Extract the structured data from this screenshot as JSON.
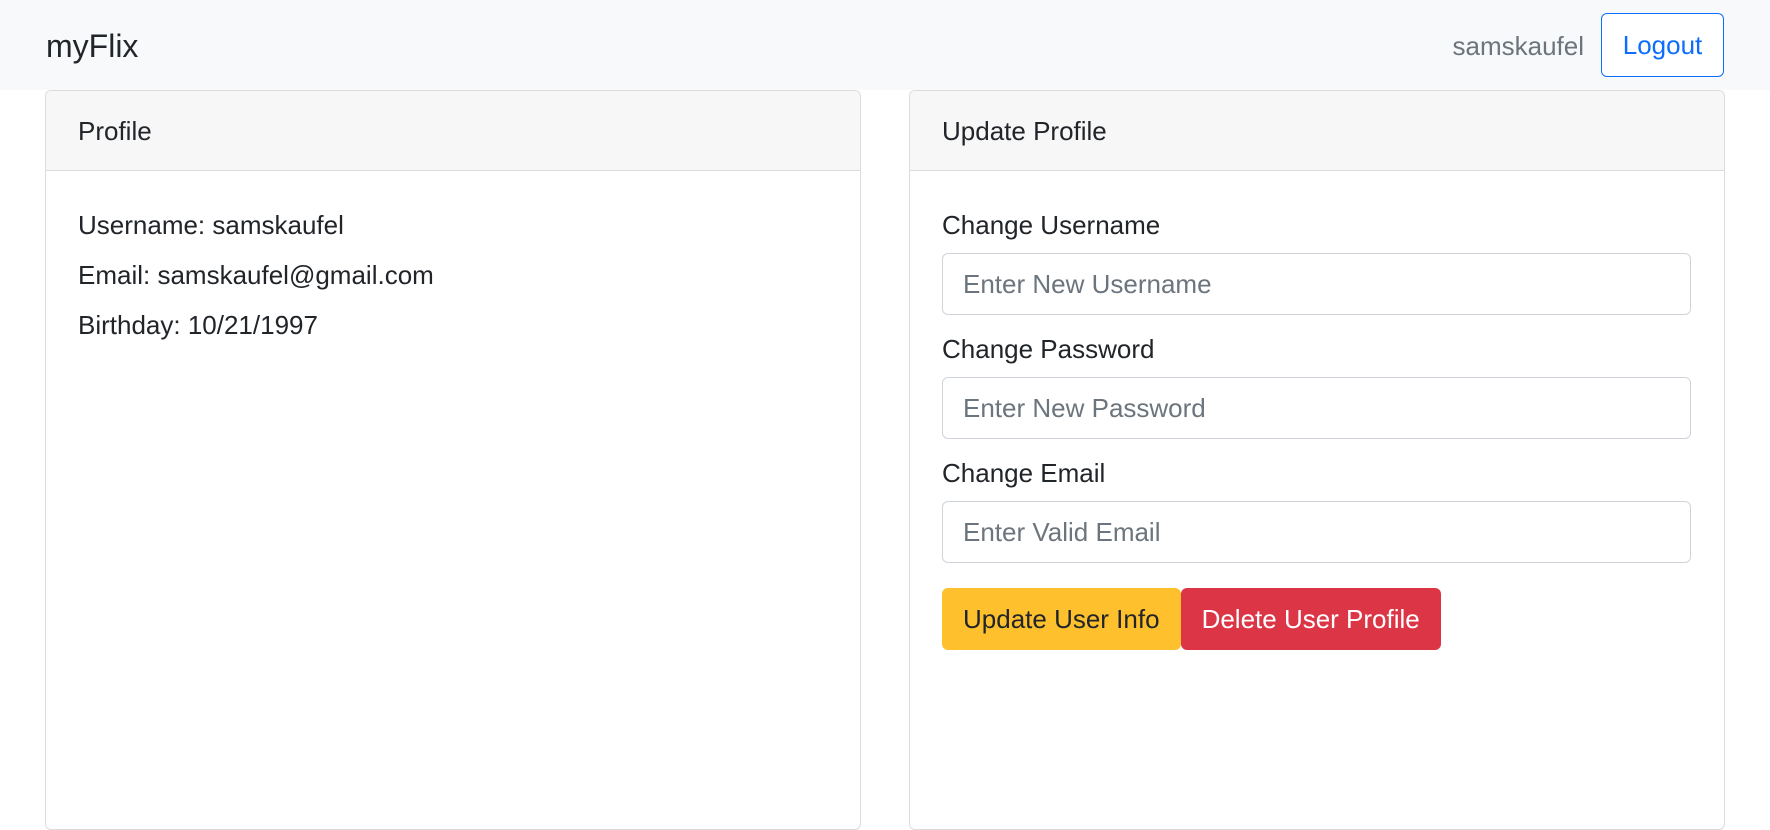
{
  "navbar": {
    "brand": "myFlix",
    "username": "samskaufel",
    "logout_label": "Logout"
  },
  "profile": {
    "title": "Profile",
    "username_line": "Username: samskaufel",
    "email_line": "Email: samskaufel@gmail.com",
    "birthday_line": "Birthday: 10/21/1997"
  },
  "update_profile": {
    "title": "Update Profile",
    "username": {
      "label": "Change Username",
      "value": "",
      "placeholder": "Enter New Username"
    },
    "password": {
      "label": "Change Password",
      "value": "",
      "placeholder": "Enter New Password"
    },
    "email": {
      "label": "Change Email",
      "value": "",
      "placeholder": "Enter Valid Email"
    },
    "update_label": "Update User Info",
    "delete_label": "Delete User Profile"
  },
  "colors": {
    "navbar_bg": "#f8f9fa",
    "primary": "#0d6efd",
    "warning": "#ffc02e",
    "danger": "#dc3545",
    "muted": "#6c757d"
  }
}
